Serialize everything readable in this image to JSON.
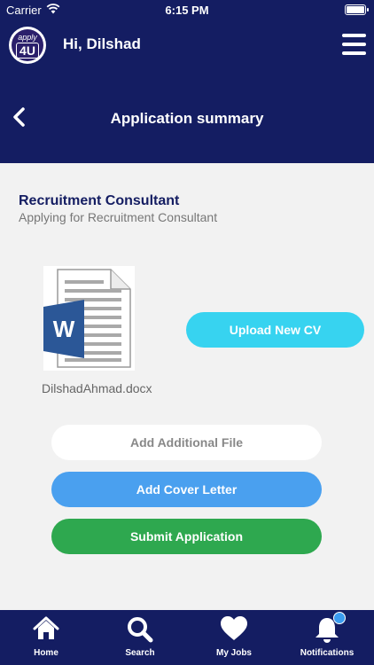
{
  "status_bar": {
    "carrier": "Carrier",
    "time": "6:15 PM"
  },
  "header": {
    "logo_top": "apply",
    "logo_bottom": "4U",
    "greeting": "Hi, Dilshad",
    "page_title": "Application summary"
  },
  "job": {
    "title": "Recruitment Consultant",
    "subtitle": "Applying for Recruitment Consultant"
  },
  "cv": {
    "doc_letter": "W",
    "filename": "DilshadAhmad.docx",
    "upload_label": "Upload New CV"
  },
  "actions": {
    "additional_file_label": "Add Additional File",
    "cover_letter_label": "Add Cover Letter",
    "submit_label": "Submit Application"
  },
  "tabs": [
    {
      "label": "Home",
      "icon": "home-icon"
    },
    {
      "label": "Search",
      "icon": "search-icon"
    },
    {
      "label": "My Jobs",
      "icon": "heart-icon"
    },
    {
      "label": "Notifications",
      "icon": "bell-icon"
    }
  ],
  "colors": {
    "header": "#141d62",
    "upload": "#37d3f0",
    "cover": "#4aa0ef",
    "submit": "#2ea84f",
    "word_blue": "#2b5797"
  }
}
